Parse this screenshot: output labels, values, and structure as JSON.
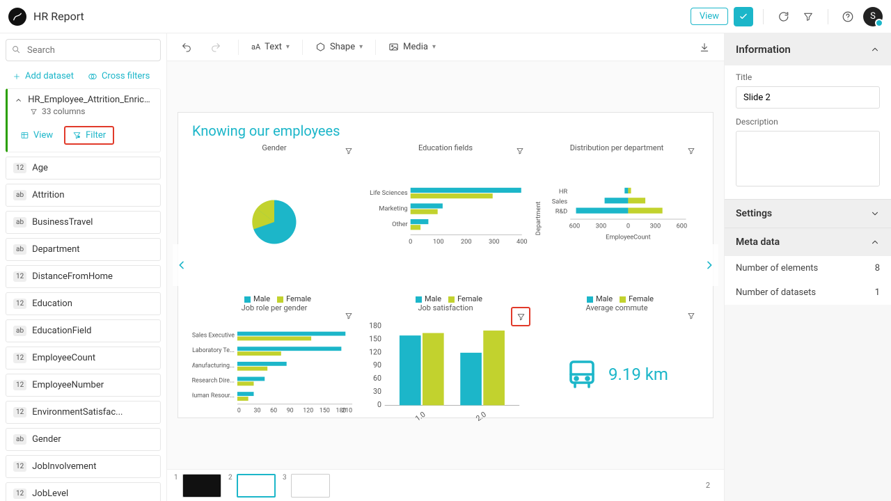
{
  "app": {
    "title": "HR Report",
    "view_btn": "View",
    "avatar_initial": "S"
  },
  "search": {
    "placeholder": "Search"
  },
  "side_actions": {
    "add_dataset": "Add dataset",
    "cross_filters": "Cross filters"
  },
  "dataset": {
    "name": "HR_Employee_Attrition_Enriche...",
    "columns_label": "33 columns",
    "view_btn": "View",
    "filter_btn": "Filter",
    "columns": [
      {
        "type": "12",
        "name": "Age"
      },
      {
        "type": "ab",
        "name": "Attrition"
      },
      {
        "type": "ab",
        "name": "BusinessTravel"
      },
      {
        "type": "ab",
        "name": "Department"
      },
      {
        "type": "12",
        "name": "DistanceFromHome"
      },
      {
        "type": "12",
        "name": "Education"
      },
      {
        "type": "ab",
        "name": "EducationField"
      },
      {
        "type": "12",
        "name": "EmployeeCount"
      },
      {
        "type": "12",
        "name": "EmployeeNumber"
      },
      {
        "type": "12",
        "name": "EnvironmentSatisfac..."
      },
      {
        "type": "ab",
        "name": "Gender"
      },
      {
        "type": "12",
        "name": "JobInvolvement"
      },
      {
        "type": "12",
        "name": "JobLevel"
      }
    ]
  },
  "toolbar": {
    "text": "Text",
    "shape": "Shape",
    "media": "Media"
  },
  "slide": {
    "title": "Knowing our employees",
    "legend_male": "Male",
    "legend_female": "Female",
    "cells": {
      "gender": {
        "title": "Gender"
      },
      "edu": {
        "title": "Education fields"
      },
      "dept": {
        "title": "Distribution per department",
        "ylabel": "Department",
        "xlabel": "EmployeeCount"
      },
      "role": {
        "title": "Job role per gender"
      },
      "sat": {
        "title": "Job satisfaction"
      },
      "commute": {
        "title": "Average commute",
        "value": "9.19 km"
      }
    }
  },
  "right": {
    "info": "Information",
    "title_label": "Title",
    "title_value": "Slide 2",
    "desc_label": "Description",
    "settings": "Settings",
    "metadata": "Meta data",
    "num_elements_label": "Number of elements",
    "num_elements_value": "8",
    "num_datasets_label": "Number of datasets",
    "num_datasets_value": "1"
  },
  "tray": {
    "count": "2"
  },
  "chart_data": [
    {
      "id": "gender",
      "type": "pie",
      "title": "Gender",
      "series": [
        {
          "name": "Male",
          "value": 62
        },
        {
          "name": "Female",
          "value": 38
        }
      ]
    },
    {
      "id": "education_fields",
      "type": "bar",
      "orientation": "horizontal",
      "title": "Education fields",
      "categories": [
        "Life Sciences",
        "Marketing",
        "Other"
      ],
      "series": [
        {
          "name": "Male",
          "values": [
            350,
            100,
            55
          ]
        },
        {
          "name": "Female",
          "values": [
            260,
            85,
            30
          ]
        }
      ],
      "xticks": [
        0,
        100,
        200,
        300,
        400
      ]
    },
    {
      "id": "distribution_per_department",
      "type": "bar",
      "orientation": "horizontal",
      "diverging": true,
      "title": "Distribution per department",
      "xlabel": "EmployeeCount",
      "ylabel": "Department",
      "categories": [
        "HR",
        "Sales",
        "R&D"
      ],
      "series": [
        {
          "name": "Male",
          "values": [
            -35,
            -260,
            -580
          ]
        },
        {
          "name": "Female",
          "values": [
            25,
            190,
            380
          ]
        }
      ],
      "xticks": [
        -600,
        -300,
        0,
        300,
        600
      ]
    },
    {
      "id": "job_role_per_gender",
      "type": "bar",
      "orientation": "horizontal",
      "title": "Job role per gender",
      "categories": [
        "Sales Executive",
        "Laboratory Te...",
        "Manufacturing...",
        "Research Dire...",
        "Human Resour..."
      ],
      "series": [
        {
          "name": "Male",
          "values": [
            195,
            190,
            90,
            50,
            30
          ]
        },
        {
          "name": "Female",
          "values": [
            135,
            80,
            55,
            30,
            20
          ]
        }
      ],
      "xticks": [
        0,
        30,
        60,
        90,
        120,
        150,
        180,
        210
      ]
    },
    {
      "id": "job_satisfaction",
      "type": "bar",
      "orientation": "vertical",
      "title": "Job satisfaction",
      "categories": [
        "1.0",
        "2.0"
      ],
      "series": [
        {
          "name": "Male",
          "values": [
            160,
            120
          ]
        },
        {
          "name": "Female",
          "values": [
            165,
            170
          ]
        }
      ],
      "yticks": [
        0,
        30,
        60,
        90,
        120,
        150,
        180
      ]
    },
    {
      "id": "average_commute",
      "type": "kpi",
      "title": "Average commute",
      "value": 9.19,
      "unit": "km"
    }
  ]
}
